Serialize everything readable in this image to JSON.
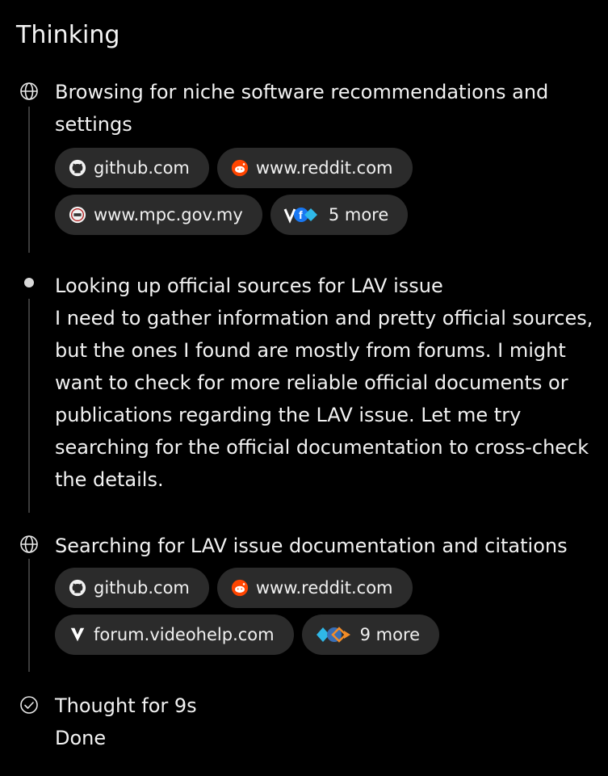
{
  "header": {
    "title": "Thinking"
  },
  "steps": [
    {
      "icon": "globe-icon",
      "title": "Browsing for niche software recommendations and settings",
      "chips": [
        {
          "label": "github.com",
          "icon": "github-icon"
        },
        {
          "label": "www.reddit.com",
          "icon": "reddit-icon"
        },
        {
          "label": "www.mpc.gov.my",
          "icon": "mpc-icon"
        },
        {
          "label": "5 more",
          "icon": "more-sources-icon"
        }
      ]
    },
    {
      "icon": "dot-icon",
      "title": "Looking up official sources for LAV issue",
      "body": "I need to gather information and pretty official sources, but the ones I found are mostly from forums. I might want to check for more reliable official documents or publications regarding the LAV issue. Let me try searching for the official documentation to cross-check the details."
    },
    {
      "icon": "globe-icon",
      "title": "Searching for LAV issue documentation and citations",
      "chips": [
        {
          "label": "github.com",
          "icon": "github-icon"
        },
        {
          "label": "www.reddit.com",
          "icon": "reddit-icon"
        },
        {
          "label": "forum.videohelp.com",
          "icon": "videohelp-icon"
        },
        {
          "label": "9 more",
          "icon": "more-sources-icon"
        }
      ]
    },
    {
      "icon": "check-circle-icon",
      "title": "Thought for 9s",
      "body": "Done"
    }
  ],
  "colors": {
    "background": "#000000",
    "chip": "#2b2b2b",
    "reddit": "#ff4500",
    "line": "#3b3b3b"
  }
}
